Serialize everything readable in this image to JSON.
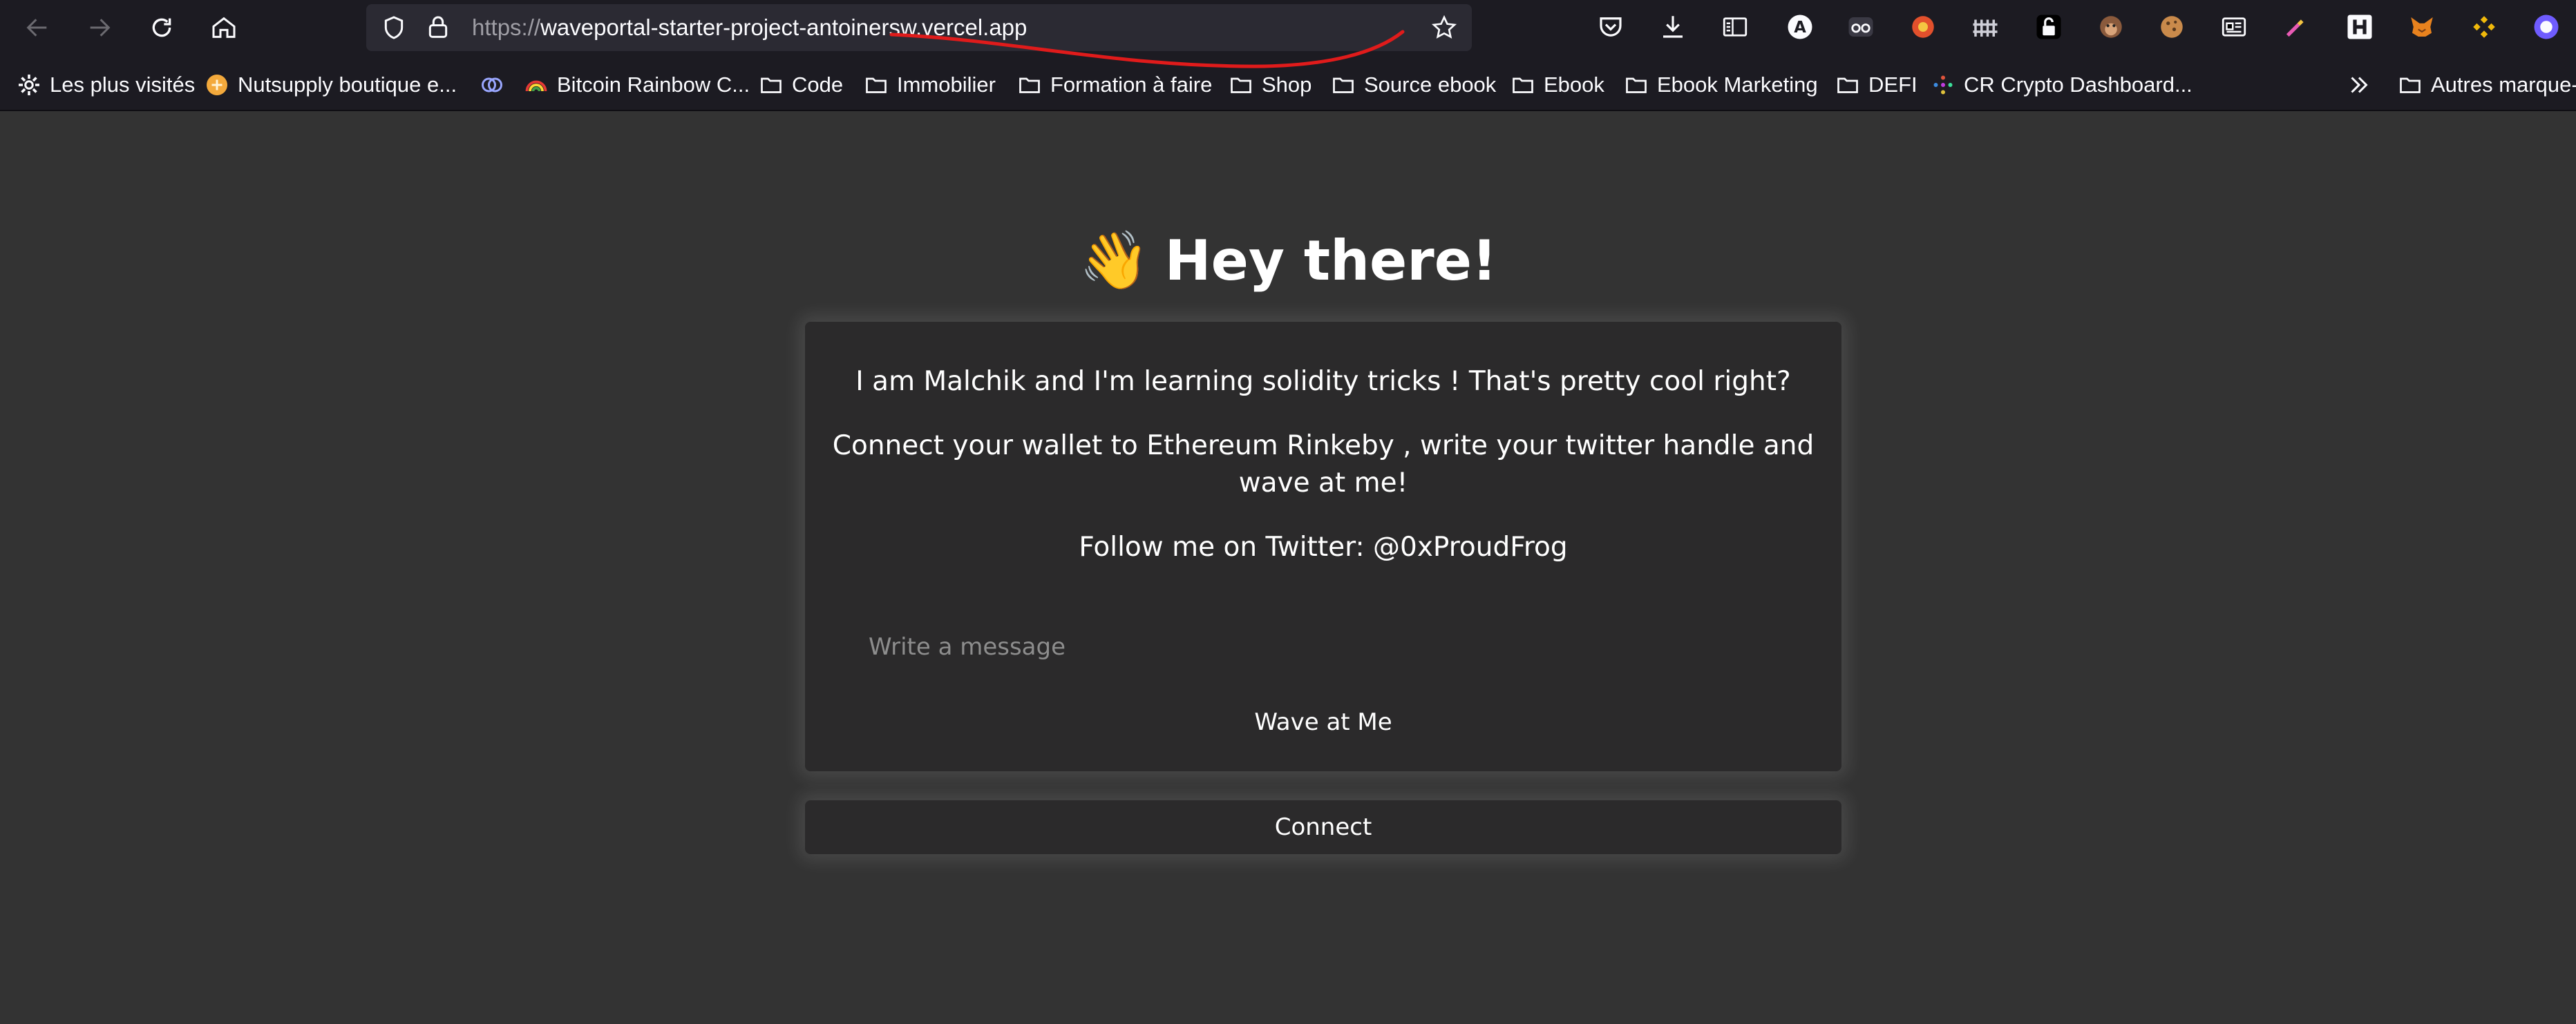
{
  "browser": {
    "url_scheme": "https://",
    "url_host": "waveportal-starter-project-antoinersw.vercel.app",
    "bookmarks": [
      {
        "label": "Les plus visités"
      },
      {
        "label": "Nutsupply boutique e..."
      },
      {
        "label": ""
      },
      {
        "label": "Bitcoin Rainbow C..."
      },
      {
        "label": "Code"
      },
      {
        "label": "Immobilier"
      },
      {
        "label": "Formation à faire"
      },
      {
        "label": "Shop"
      },
      {
        "label": "Source ebook"
      },
      {
        "label": "Ebook"
      },
      {
        "label": "Ebook Marketing"
      },
      {
        "label": "DEFI"
      },
      {
        "label": "CR Crypto Dashboard..."
      },
      {
        "label": "Autres marque-..."
      }
    ],
    "extension_letter": "A"
  },
  "page": {
    "wave_emoji": "👋",
    "heading": "Hey there!",
    "bio": "I am Malchik and I'm learning solidity tricks ! That's pretty cool right?",
    "instructions": "Connect your wallet to Ethereum Rinkeby , write your twitter handle and wave at me!",
    "follow": "Follow me on Twitter: @0xProudFrog",
    "message_placeholder": "Write a message",
    "wave_button": "Wave at Me",
    "connect_button": "Connect"
  },
  "colors": {
    "page_bg": "#333333",
    "card_bg": "#2b2a2b",
    "chrome_bg": "#1c1b22",
    "urlbar_bg": "#2b2a33",
    "annotation_red": "#e01b1b"
  }
}
